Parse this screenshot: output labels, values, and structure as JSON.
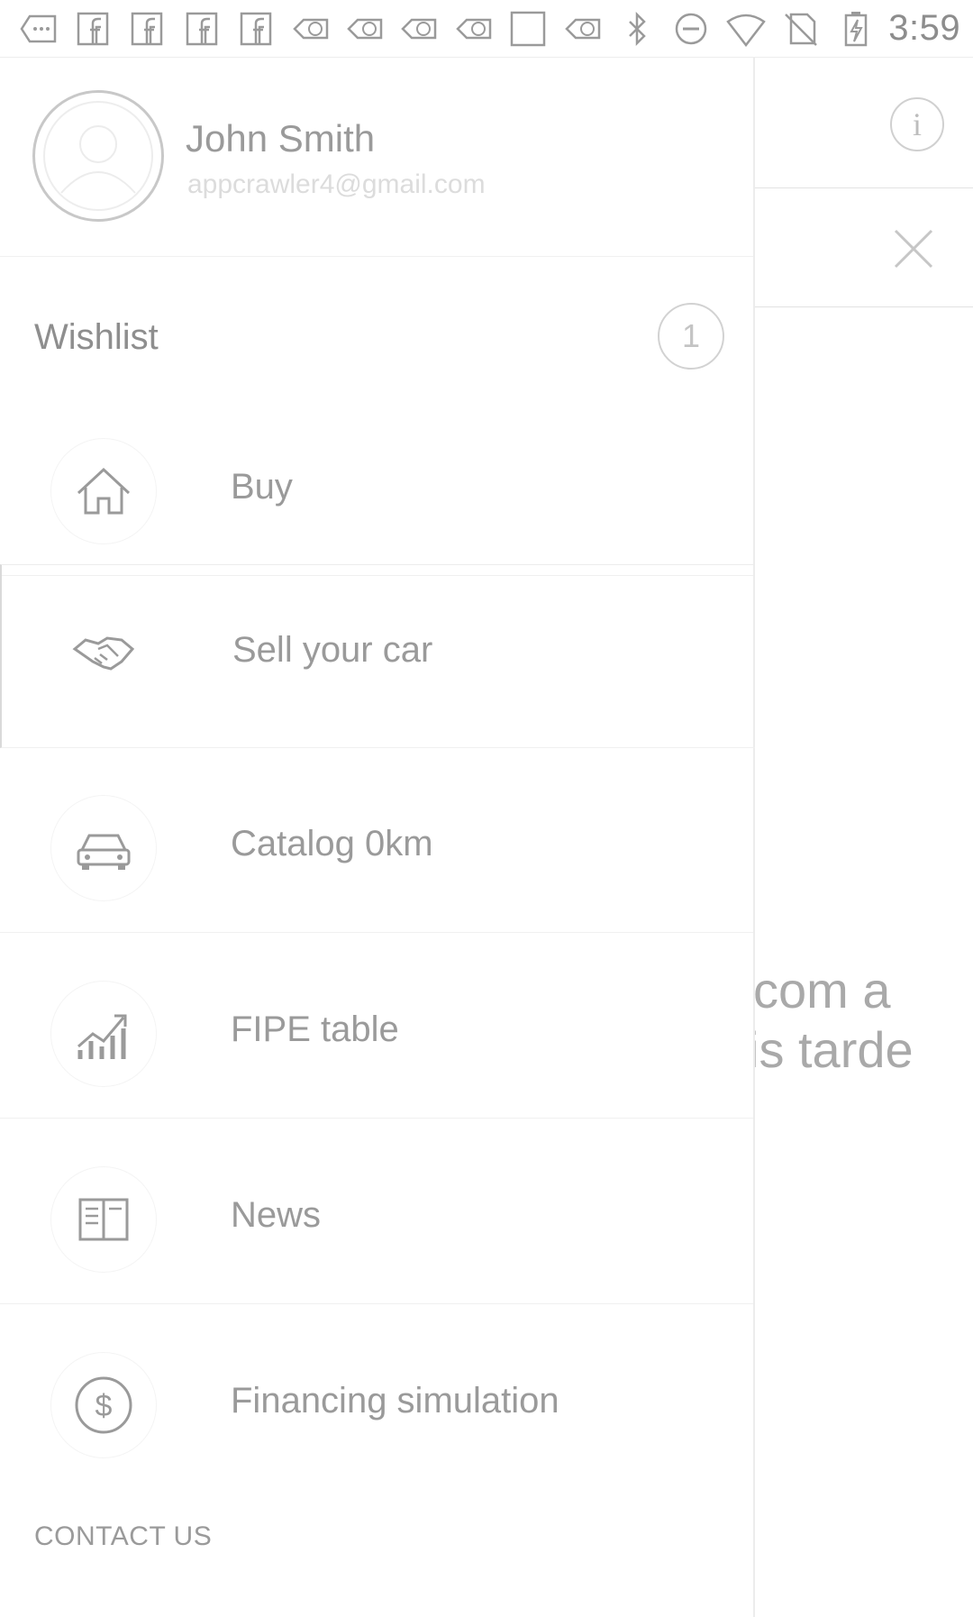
{
  "status_bar": {
    "time": "3:59",
    "icons": [
      "back-overflow-icon",
      "facebook-icon",
      "facebook-icon",
      "facebook-icon",
      "facebook-icon",
      "notification-13-icon",
      "notification-13-icon",
      "notification-13-icon",
      "notification-13-icon",
      "blank-square-icon",
      "notification-13-icon",
      "bluetooth-icon",
      "do-not-disturb-icon",
      "wifi-icon",
      "no-sim-icon",
      "battery-charging-icon"
    ]
  },
  "profile": {
    "name": "John Smith",
    "email": "appcrawler4@gmail.com"
  },
  "wishlist": {
    "label": "Wishlist",
    "count": "1"
  },
  "menu": {
    "items": [
      {
        "label": "Buy",
        "icon": "home-icon"
      },
      {
        "label": "Sell your car",
        "icon": "handshake-icon"
      },
      {
        "label": "Catalog 0km",
        "icon": "car-icon"
      },
      {
        "label": "FIPE table",
        "icon": "chart-growth-icon"
      },
      {
        "label": "News",
        "icon": "newspaper-icon"
      },
      {
        "label": "Financing simulation",
        "icon": "dollar-icon"
      }
    ]
  },
  "contact_label": "CONTACT US",
  "background": {
    "text_line1": "com a",
    "text_line2": "is tarde",
    "info_glyph": "i"
  },
  "colors": {
    "text_primary": "#9a9a9a",
    "divider": "#f0f0f0",
    "muted": "#dcdcdc"
  }
}
